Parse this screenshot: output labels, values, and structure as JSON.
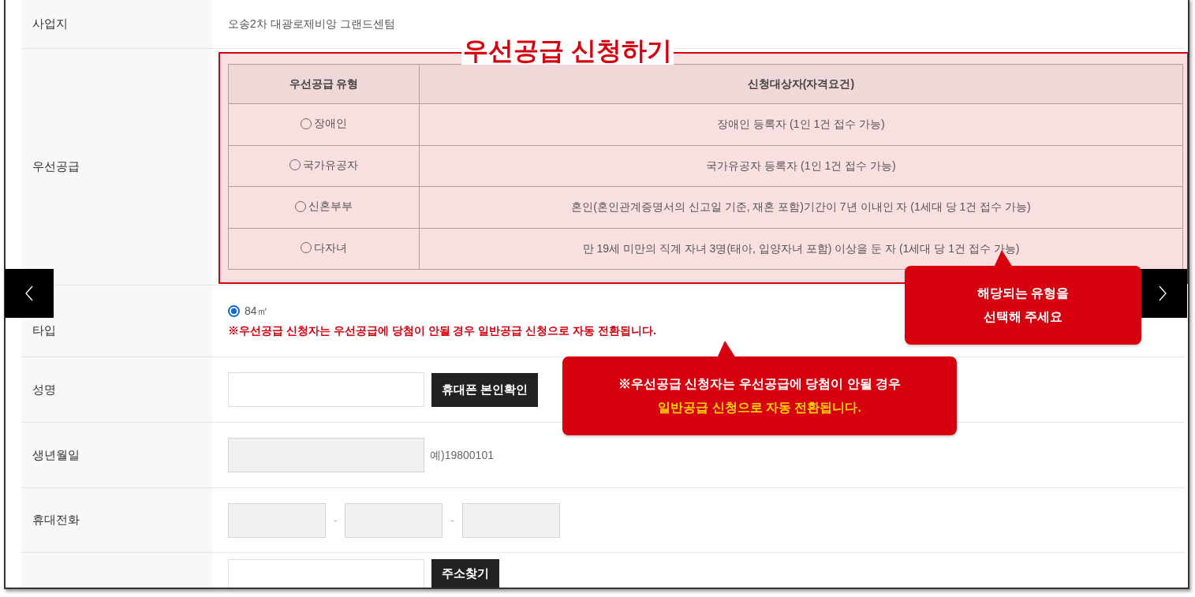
{
  "site": {
    "label": "사업지",
    "value": "오송2차 대광로제비앙 그랜드센텀"
  },
  "priority": {
    "label": "우선공급",
    "title": "우선공급 신청하기",
    "columns": [
      "우선공급 유형",
      "신청대상자(자격요건)"
    ],
    "rows": [
      {
        "type": "장애인",
        "selected": false,
        "requirement": "장애인 등록자 (1인 1건 접수 가능)"
      },
      {
        "type": "국가유공자",
        "selected": false,
        "requirement": "국가유공자 등록자 (1인 1건 접수 가능)"
      },
      {
        "type": "신혼부부",
        "selected": false,
        "requirement": "혼인(혼인관계증명서의 신고일 기준, 재혼 포함)기간이 7년 이내인 자 (1세대 당 1건 접수 가능)"
      },
      {
        "type": "다자녀",
        "selected": false,
        "requirement": "만 19세 미만의 직계 자녀 3명(태아, 입양자녀 포함) 이상을 둔 자 (1세대 당 1건 접수 가능)"
      }
    ]
  },
  "unit_type": {
    "label": "타입",
    "options": [
      {
        "label": "84㎡",
        "selected": true
      }
    ],
    "notice": "※우선공급 신청자는 우선공급에 당첨이 안될 경우 일반공급 신청으로 자동 전환됩니다."
  },
  "name": {
    "label": "성명",
    "button": "휴대폰 본인확인"
  },
  "birth": {
    "label": "생년월일",
    "hint": "예)19800101",
    "disabled": true
  },
  "phone": {
    "label": "휴대전화",
    "separators": [
      "-",
      "-"
    ],
    "disabled": true
  },
  "address": {
    "button": "주소찾기"
  },
  "callouts": [
    {
      "lines": [
        {
          "text": "해당되는 유형을",
          "highlight": false
        },
        {
          "text": "선택해 주세요",
          "highlight": false
        }
      ]
    },
    {
      "lines": [
        {
          "text": "※우선공급 신청자는 우선공급에 당첨이 안될 경우",
          "highlight": false
        },
        {
          "text": "일반공급 신청으로 자동 전환됩니다.",
          "highlight": true
        }
      ]
    }
  ]
}
